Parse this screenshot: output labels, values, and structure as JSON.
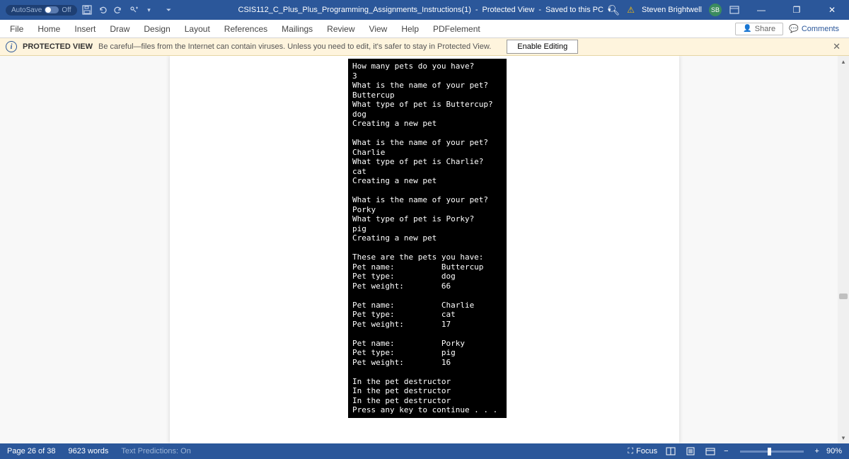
{
  "titlebar": {
    "autosave_label": "AutoSave",
    "autosave_state": "Off",
    "doc_title": "CSIS112_C_Plus_Plus_Programming_Assignments_Instructions(1)",
    "mode": "Protected View",
    "save_status": "Saved to this PC",
    "user_name": "Steven Brightwell",
    "user_initials": "SB"
  },
  "tabs": {
    "file": "File",
    "home": "Home",
    "insert": "Insert",
    "draw": "Draw",
    "design": "Design",
    "layout": "Layout",
    "references": "References",
    "mailings": "Mailings",
    "review": "Review",
    "view": "View",
    "help": "Help",
    "pdfelement": "PDFelement",
    "share": "Share",
    "comments": "Comments"
  },
  "protected": {
    "label": "PROTECTED VIEW",
    "message": "Be careful—files from the Internet can contain viruses. Unless you need to edit, it's safer to stay in Protected View.",
    "enable": "Enable Editing"
  },
  "console_text": "How many pets do you have?\n3\nWhat is the name of your pet?\nButtercup\nWhat type of pet is Buttercup?\ndog\nCreating a new pet\n\nWhat is the name of your pet?\nCharlie\nWhat type of pet is Charlie?\ncat\nCreating a new pet\n\nWhat is the name of your pet?\nPorky\nWhat type of pet is Porky?\npig\nCreating a new pet\n\nThese are the pets you have:\nPet name:          Buttercup\nPet type:          dog\nPet weight:        66\n\nPet name:          Charlie\nPet type:          cat\nPet weight:        17\n\nPet name:          Porky\nPet type:          pig\nPet weight:        16\n\nIn the pet destructor\nIn the pet destructor\nIn the pet destructor\nPress any key to continue . . .",
  "status": {
    "page": "Page 26 of 38",
    "words": "9623 words",
    "predictions": "Text Predictions: On",
    "focus": "Focus",
    "zoom": "90%"
  }
}
